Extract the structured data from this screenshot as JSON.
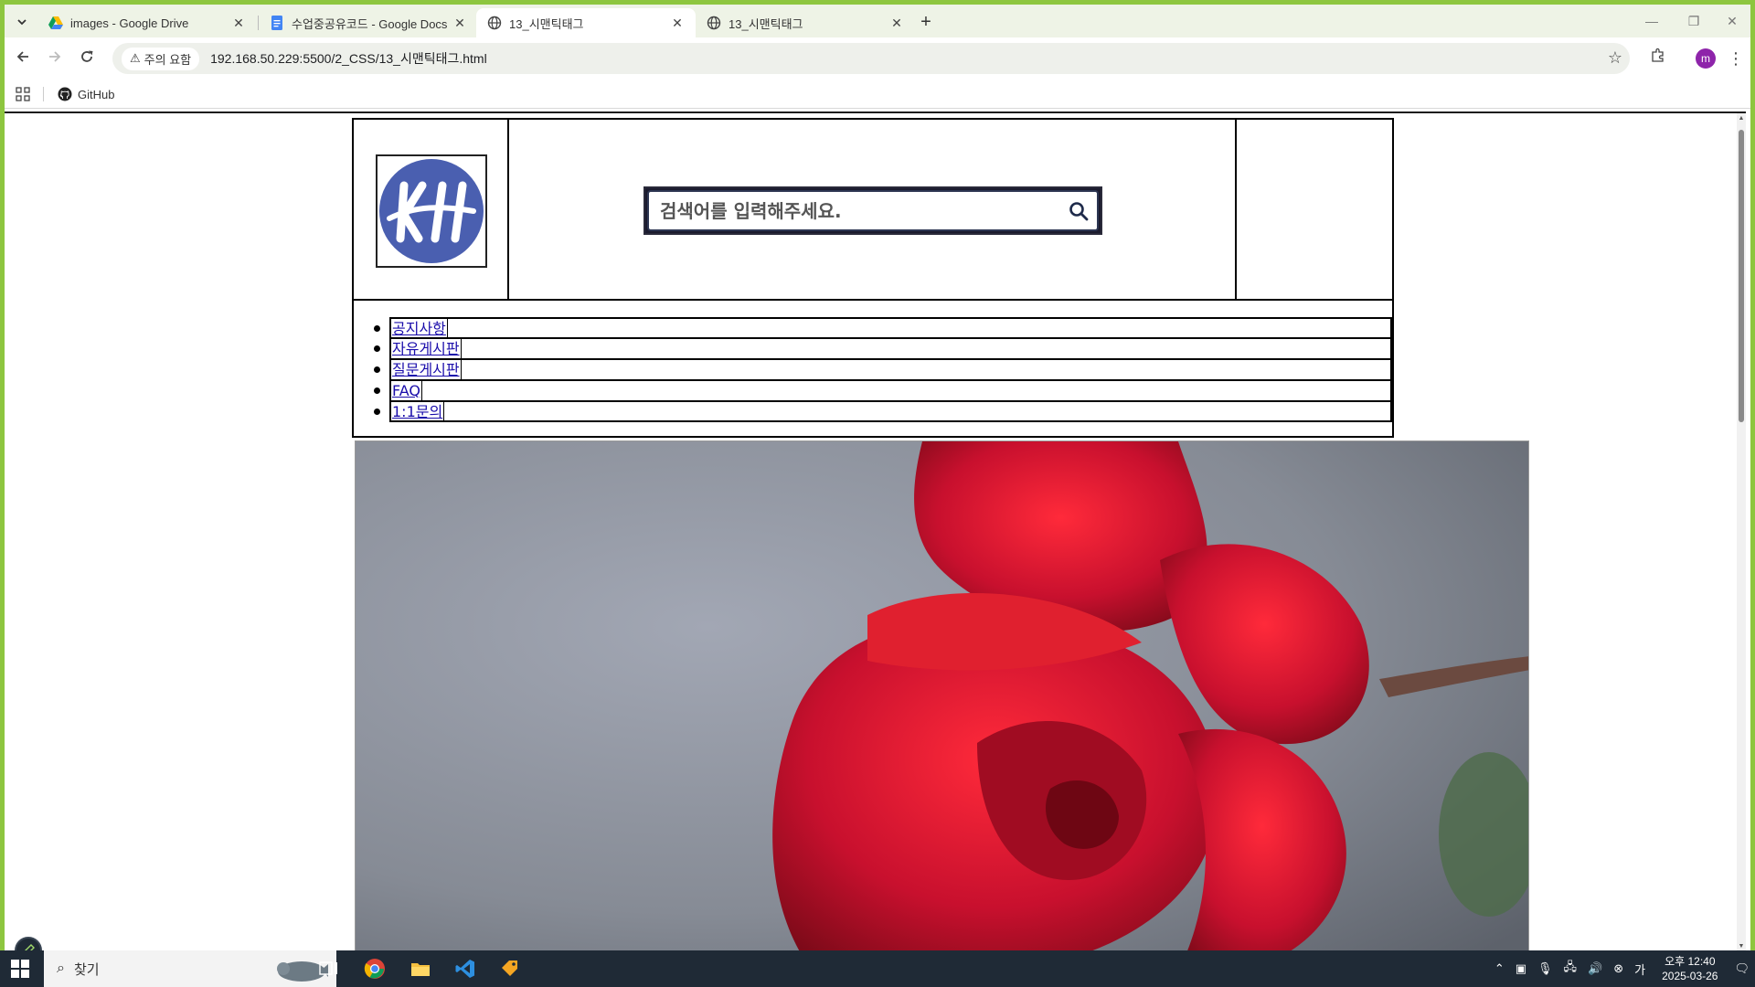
{
  "browser": {
    "tabs": [
      {
        "title": "images - Google Drive",
        "icon": "google-drive-icon",
        "active": false
      },
      {
        "title": "수업중공유코드 - Google Docs",
        "icon": "google-docs-icon",
        "active": false
      },
      {
        "title": "13_시맨틱태그",
        "icon": "globe-icon",
        "active": true
      },
      {
        "title": "13_시맨틱태그",
        "icon": "globe-icon",
        "active": false
      }
    ],
    "security_label": "주의 요함",
    "url": "192.168.50.229:5500/2_CSS/13_시맨틱태그.html",
    "profile_initial": "m",
    "bookmarks": [
      {
        "label": "GitHub",
        "icon": "github-icon"
      }
    ]
  },
  "page": {
    "search_placeholder": "검색어를 입력해주세요.",
    "nav_items": [
      "공지사항",
      "자유게시판",
      "질문게시판",
      "FAQ",
      "1:1문의"
    ]
  },
  "taskbar": {
    "search_label": "찾기",
    "clock_ampm_time": "오후 12:40",
    "clock_date": "2025-03-26"
  },
  "colors": {
    "frame_accent": "#8dc63f",
    "logo_blue": "#4a5fb0",
    "link": "#1a0dab",
    "rose_red": "#c8102e"
  }
}
